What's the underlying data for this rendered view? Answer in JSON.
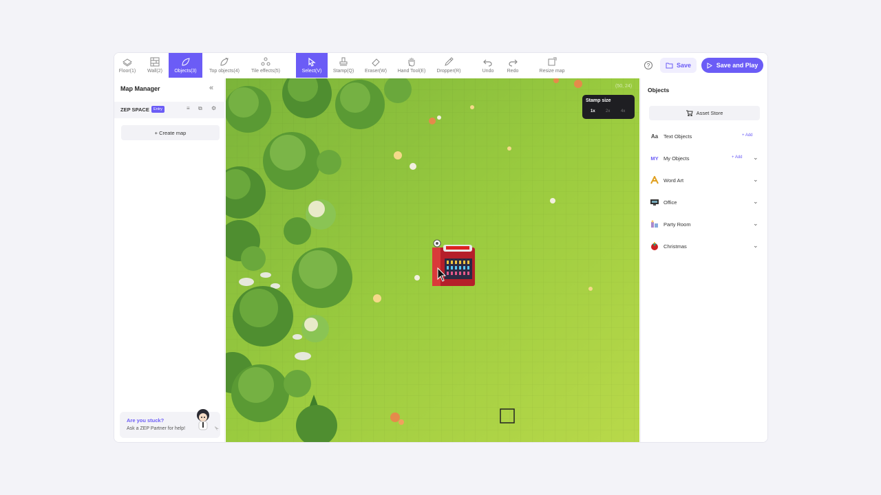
{
  "toolbar": {
    "tools": [
      {
        "label": "Floor(1)",
        "icon": "floor-icon"
      },
      {
        "label": "Wall(2)",
        "icon": "wall-icon"
      },
      {
        "label": "Objects(3)",
        "icon": "objects-icon",
        "active": true
      },
      {
        "label": "Top objects(4)",
        "icon": "top-objects-icon"
      },
      {
        "label": "Tile effects(5)",
        "icon": "tile-effects-icon"
      },
      {
        "label": "Select(V)",
        "icon": "cursor-icon",
        "active": true
      },
      {
        "label": "Stamp(Q)",
        "icon": "stamp-icon"
      },
      {
        "label": "Eraser(W)",
        "icon": "eraser-icon"
      },
      {
        "label": "Hand Tool(E)",
        "icon": "hand-icon"
      },
      {
        "label": "Dropper(R)",
        "icon": "dropper-icon"
      },
      {
        "label": "Undo",
        "icon": "undo-icon"
      },
      {
        "label": "Redo",
        "icon": "redo-icon"
      },
      {
        "label": "Resize map",
        "icon": "resize-icon"
      }
    ],
    "help": "?",
    "save_label": "Save",
    "play_label": "Save and Play",
    "accent": "#6b5cf6"
  },
  "left": {
    "title": "Map Manager",
    "space_name": "ZEP SPACE",
    "entry_badge": "Entry",
    "create_map": "+ Create map",
    "help_question": "Are you stuck?",
    "help_sub": "Ask a ZEP Partner for help!"
  },
  "map": {
    "stamp_title": "Stamp size",
    "stamp_options": [
      "1x",
      "2x",
      "4x"
    ],
    "coords": "(50, 24)"
  },
  "right": {
    "title": "Objects",
    "asset_store": "Asset Store",
    "categories": [
      {
        "icon": "Aa",
        "label": "Text Objects",
        "add": "+ Add"
      },
      {
        "icon": "MY",
        "label": "My Objects",
        "add": "+ Add"
      },
      {
        "icon": "word-art-icon",
        "label": "Word Art"
      },
      {
        "icon": "office-icon",
        "label": "Office"
      },
      {
        "icon": "party-room-icon",
        "label": "Party Room"
      },
      {
        "icon": "christmas-icon",
        "label": "Christmas"
      }
    ]
  }
}
